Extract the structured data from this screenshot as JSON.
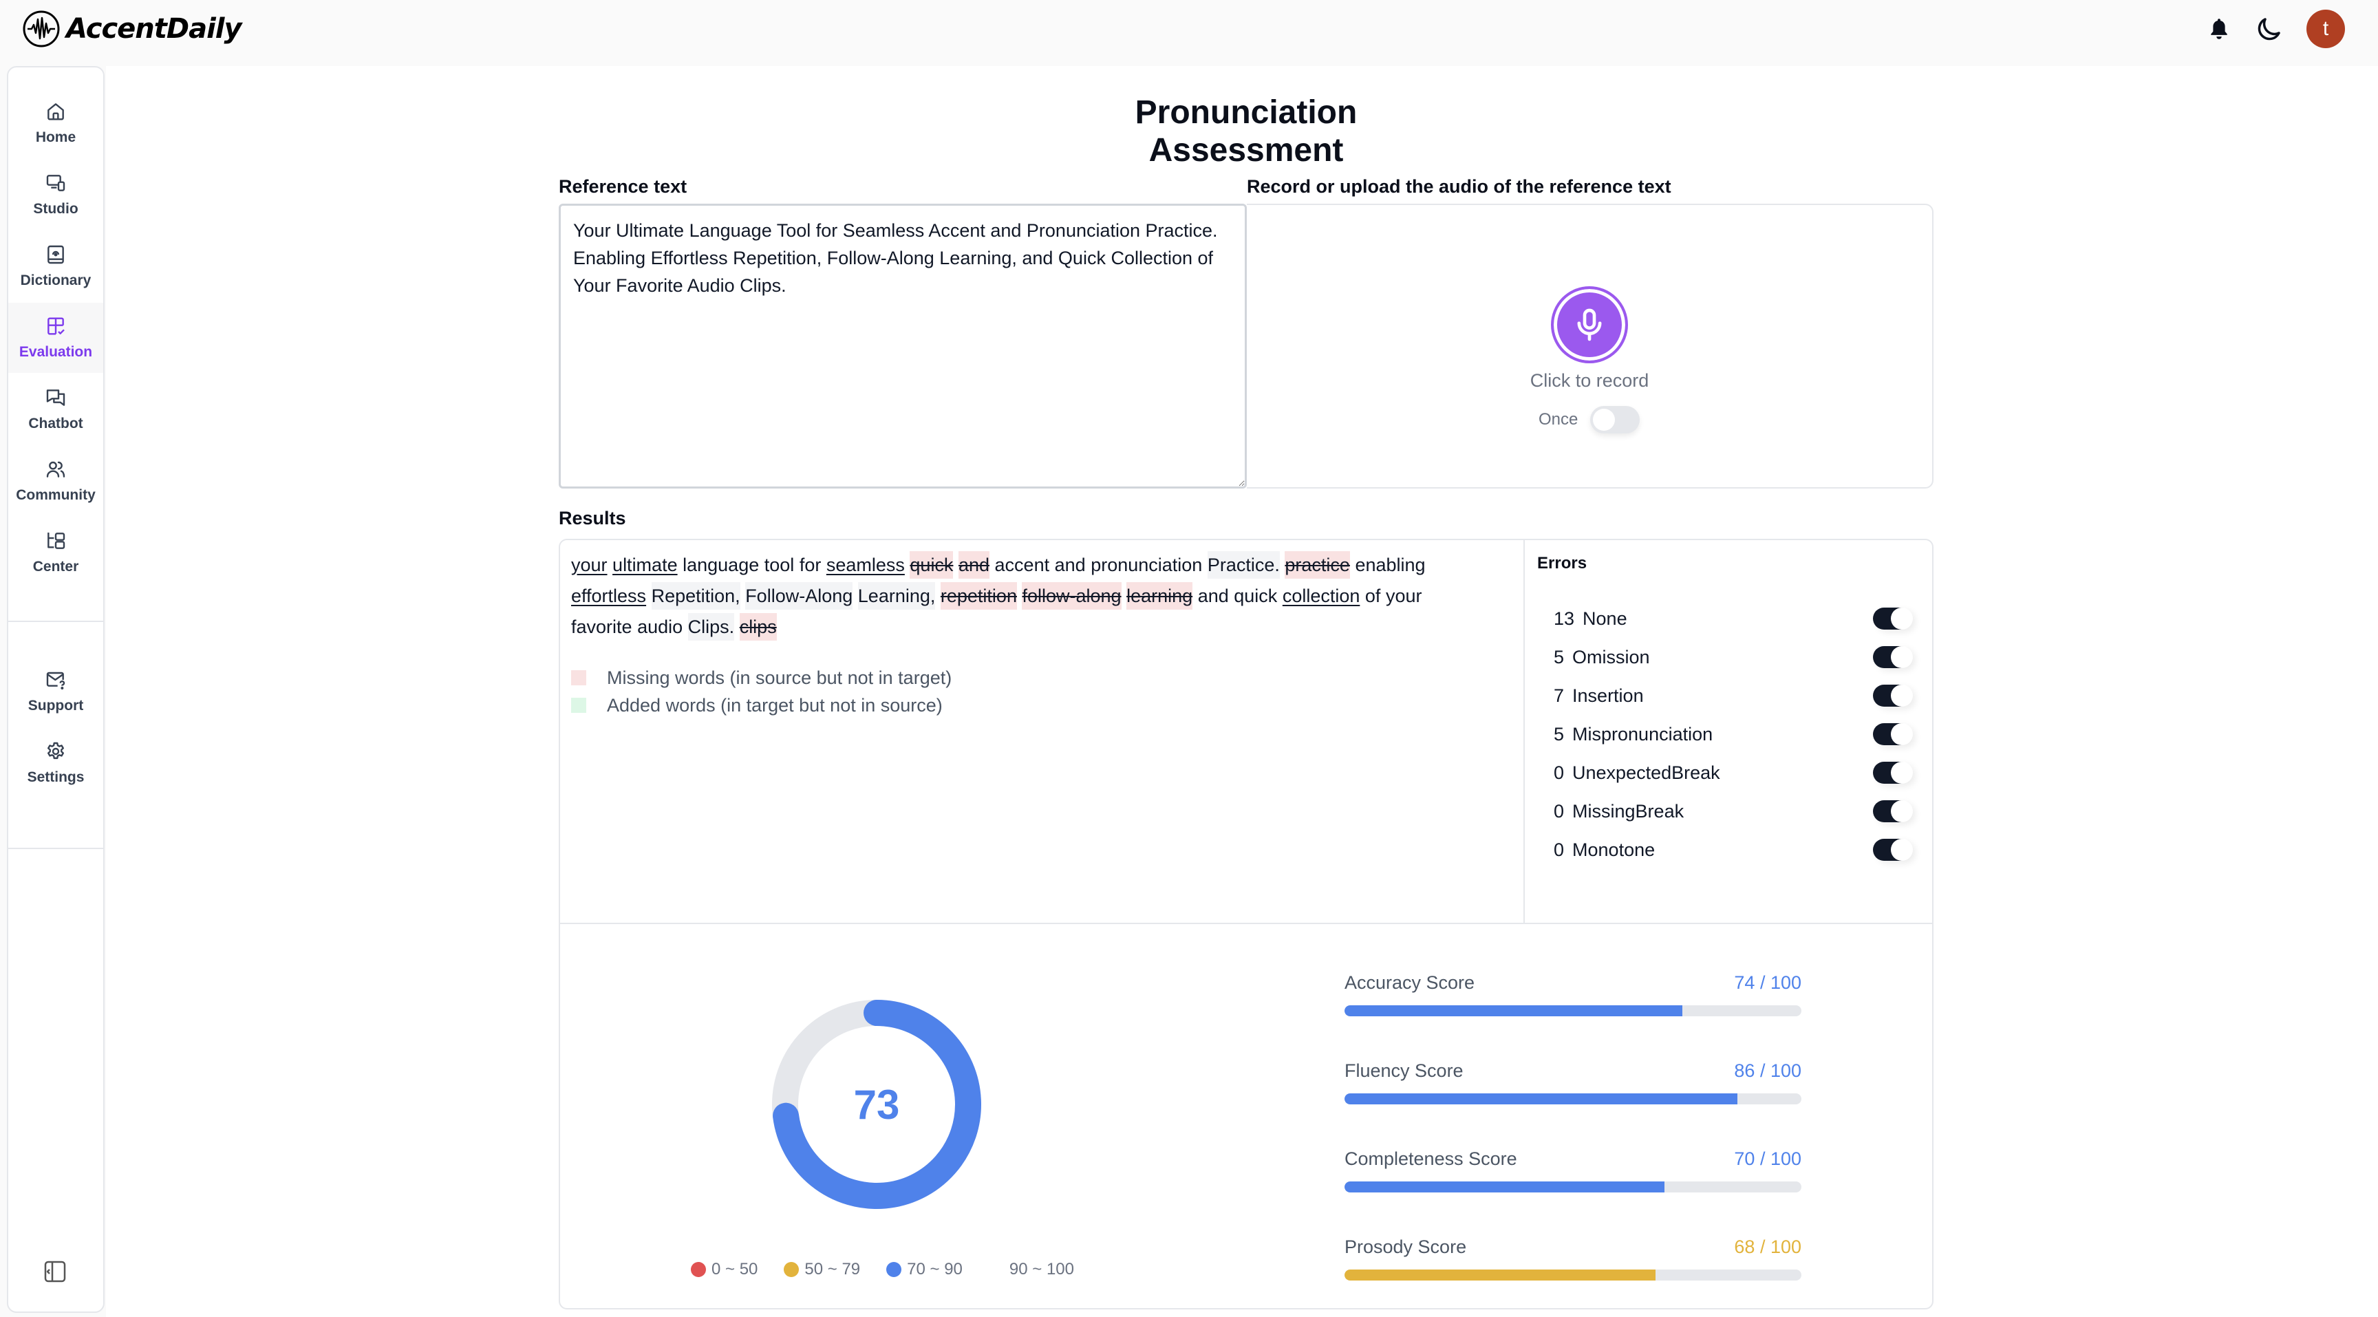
{
  "app": {
    "name": "AccentDaily",
    "user_initial": "t",
    "avatar_color": "#b03f22"
  },
  "header_icons": [
    "bell-icon",
    "moon-icon"
  ],
  "sidebar": {
    "items": [
      {
        "label": "Home",
        "icon": "home-icon",
        "active": false
      },
      {
        "label": "Studio",
        "icon": "studio-icon",
        "active": false
      },
      {
        "label": "Dictionary",
        "icon": "dictionary-icon",
        "active": false
      },
      {
        "label": "Evaluation",
        "icon": "evaluation-icon",
        "active": true
      },
      {
        "label": "Chatbot",
        "icon": "chat-icon",
        "active": false
      },
      {
        "label": "Community",
        "icon": "community-icon",
        "active": false
      },
      {
        "label": "Center",
        "icon": "center-icon",
        "active": false
      }
    ],
    "bottom_items": [
      {
        "label": "Support",
        "icon": "support-mail-icon"
      },
      {
        "label": "Settings",
        "icon": "gear-icon"
      }
    ],
    "collapse_icon": "sidebar-collapse-icon",
    "active_color": "#7c3aed"
  },
  "page": {
    "title": "Pronunciation Assessment"
  },
  "reference": {
    "label": "Reference text",
    "value": "Your Ultimate Language Tool for Seamless Accent and Pronunciation Practice. Enabling Effortless Repetition, Follow-Along Learning, and Quick Collection of Your Favorite Audio Clips."
  },
  "recorder": {
    "label": "Record or upload the audio of the reference text",
    "caption": "Click to record",
    "once_label": "Once",
    "once_enabled": false,
    "accent_color": "#9b59ee"
  },
  "results": {
    "label": "Results",
    "words": [
      {
        "text": "your",
        "type": "underline"
      },
      {
        "text": "ultimate",
        "type": "underline"
      },
      {
        "text": "language",
        "type": "normal"
      },
      {
        "text": "tool",
        "type": "normal"
      },
      {
        "text": "for",
        "type": "normal"
      },
      {
        "text": "seamless",
        "type": "underline"
      },
      {
        "text": "quick",
        "type": "missing"
      },
      {
        "text": "and",
        "type": "missing"
      },
      {
        "text": "accent",
        "type": "normal"
      },
      {
        "text": "and",
        "type": "normal"
      },
      {
        "text": "pronunciation",
        "type": "normal"
      },
      {
        "text": "Practice.",
        "type": "mispronounced"
      },
      {
        "text": "practice",
        "type": "missing"
      },
      {
        "text": "enabling",
        "type": "normal"
      },
      {
        "text": "effortless",
        "type": "underline"
      },
      {
        "text": "Repetition,",
        "type": "mispronounced"
      },
      {
        "text": "Follow-Along",
        "type": "mispronounced"
      },
      {
        "text": "Learning,",
        "type": "mispronounced"
      },
      {
        "text": "repetition",
        "type": "missing"
      },
      {
        "text": "follow-along",
        "type": "missing"
      },
      {
        "text": "learning",
        "type": "missing"
      },
      {
        "text": "and",
        "type": "normal"
      },
      {
        "text": "quick",
        "type": "normal"
      },
      {
        "text": "collection",
        "type": "underline"
      },
      {
        "text": "of",
        "type": "normal"
      },
      {
        "text": "your",
        "type": "normal"
      },
      {
        "text": "favorite",
        "type": "normal"
      },
      {
        "text": "audio",
        "type": "normal"
      },
      {
        "text": "Clips.",
        "type": "mispronounced"
      },
      {
        "text": "clips",
        "type": "missing"
      }
    ],
    "legend": [
      {
        "label": "Missing words (in source but not in target)",
        "color": "#f9e2e2"
      },
      {
        "label": "Added words (in target but not in source)",
        "color": "#ddf7e6"
      }
    ],
    "errors": {
      "title": "Errors",
      "items": [
        {
          "count": "13",
          "label": "None",
          "enabled": true
        },
        {
          "count": "5",
          "label": "Omission",
          "enabled": true
        },
        {
          "count": "7",
          "label": "Insertion",
          "enabled": true
        },
        {
          "count": "5",
          "label": "Mispronunciation",
          "enabled": true
        },
        {
          "count": "0",
          "label": "UnexpectedBreak",
          "enabled": true
        },
        {
          "count": "0",
          "label": "MissingBreak",
          "enabled": true
        },
        {
          "count": "0",
          "label": "Monotone",
          "enabled": true
        }
      ]
    }
  },
  "scores": {
    "overall": 73,
    "overall_color": "#4f82ea",
    "ranges": [
      {
        "label": "0 ~ 50",
        "color": "#e05252"
      },
      {
        "label": "50 ~ 79",
        "color": "#e2b33c"
      },
      {
        "label": "70 ~ 90",
        "color": "#4f82ea"
      },
      {
        "label": "90 ~ 100",
        "color": "#ffffff"
      }
    ],
    "items": [
      {
        "name": "Accuracy Score",
        "value": 74,
        "max": 100,
        "display": "74 / 100",
        "color": "#4f82ea"
      },
      {
        "name": "Fluency Score",
        "value": 86,
        "max": 100,
        "display": "86 / 100",
        "color": "#4f82ea"
      },
      {
        "name": "Completeness Score",
        "value": 70,
        "max": 100,
        "display": "70 / 100",
        "color": "#4f82ea"
      },
      {
        "name": "Prosody Score",
        "value": 68,
        "max": 100,
        "display": "68 / 100",
        "color": "#e2b33c"
      }
    ]
  }
}
